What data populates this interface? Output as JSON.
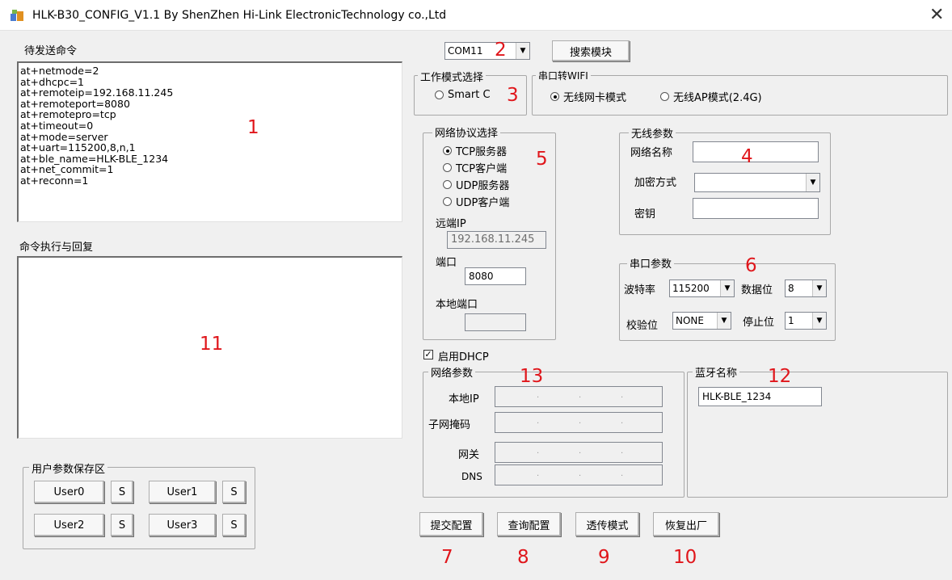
{
  "window": {
    "title": "HLK-B30_CONFIG_V1.1 By ShenZhen Hi-Link ElectronicTechnology co.,Ltd",
    "close_glyph": "✕"
  },
  "left": {
    "send_cmd_label": "待发送命令",
    "commands": "at+netmode=2\nat+dhcpc=1\nat+remoteip=192.168.11.245\nat+remoteport=8080\nat+remotepro=tcp\nat+timeout=0\nat+mode=server\nat+uart=115200,8,n,1\nat+ble_name=HLK-BLE_1234\nat+net_commit=1\nat+reconn=1",
    "reply_label": "命令执行与回复",
    "reply_text": "",
    "user_group_title": "用户参数保存区",
    "users": [
      {
        "label": "User0",
        "save": "S"
      },
      {
        "label": "User1",
        "save": "S"
      },
      {
        "label": "User2",
        "save": "S"
      },
      {
        "label": "User3",
        "save": "S"
      }
    ]
  },
  "top": {
    "com_port": "COM11",
    "search_button": "搜索模块"
  },
  "work_mode": {
    "title": "工作模式选择",
    "smart_c": "Smart C",
    "serial_wifi_title": "串口转WIFI",
    "wifi_card_mode": "无线网卡模式",
    "ap_mode": "无线AP模式(2.4G)"
  },
  "protocol": {
    "title": "网络协议选择",
    "options": [
      "TCP服务器",
      "TCP客户端",
      "UDP服务器",
      "UDP客户端"
    ],
    "remote_ip_label": "远端IP",
    "remote_ip": "192.168.11.245",
    "port_label": "端口",
    "port": "8080",
    "local_port_label": "本地端口",
    "local_port": ""
  },
  "wireless": {
    "title": "无线参数",
    "ssid_label": "网络名称",
    "ssid": "",
    "encrypt_label": "加密方式",
    "encrypt": "",
    "key_label": "密钥",
    "key": ""
  },
  "serial": {
    "title": "串口参数",
    "baud_label": "波特率",
    "baud": "115200",
    "databits_label": "数据位",
    "databits": "8",
    "parity_label": "校验位",
    "parity": "NONE",
    "stopbits_label": "停止位",
    "stopbits": "1"
  },
  "dhcp": {
    "checked_glyph": "✓",
    "label": "启用DHCP"
  },
  "net_params": {
    "title": "网络参数",
    "local_ip_label": "本地IP",
    "subnet_label": "子网掩码",
    "gateway_label": "网关",
    "dns_label": "DNS",
    "ip_dot": "."
  },
  "bluetooth": {
    "title": "蓝牙名称",
    "name": "HLK-BLE_1234"
  },
  "actions": {
    "submit": "提交配置",
    "query": "查询配置",
    "passthrough": "透传模式",
    "restore": "恢复出厂"
  },
  "annotations": {
    "n1": "1",
    "n2": "2",
    "n3": "3",
    "n4": "4",
    "n5": "5",
    "n6": "6",
    "n7": "7",
    "n8": "8",
    "n9": "9",
    "n10": "10",
    "n11": "11",
    "n12": "12",
    "n13": "13"
  },
  "colors": {
    "annotation": "#e0161b",
    "window_bg": "#f0f0f0"
  },
  "icons": {
    "app": "app-icon",
    "dropdown": "chevron-down-icon",
    "close": "close-icon"
  }
}
